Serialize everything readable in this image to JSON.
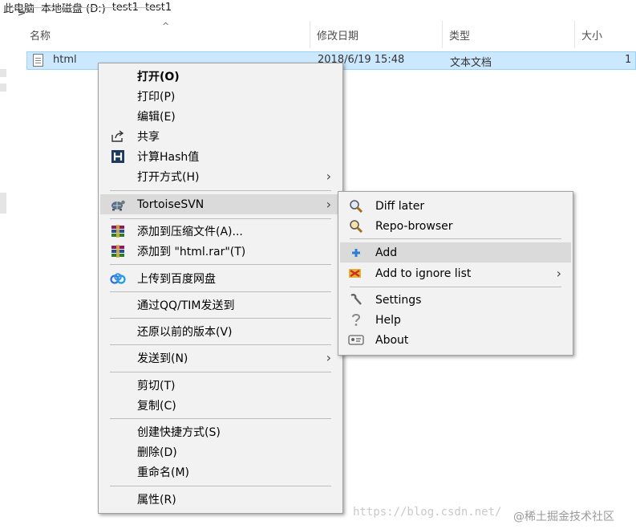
{
  "breadcrumb": [
    "此电脑",
    "本地磁盘 (D:)",
    "test1",
    "test1"
  ],
  "columns": {
    "name": "名称",
    "modified": "修改日期",
    "type": "类型",
    "size": "大小"
  },
  "file": {
    "name": "html",
    "modified": "2018/6/19 15:48",
    "type": "文本文档",
    "size": "1"
  },
  "context_menu": {
    "open": "打开(O)",
    "print": "打印(P)",
    "edit": "编辑(E)",
    "share": "共享",
    "hash": "计算Hash值",
    "open_with": "打开方式(H)",
    "tortoise": "TortoiseSVN",
    "add_archive": "添加到压缩文件(A)...",
    "add_rar": "添加到 \"html.rar\"(T)",
    "baidu": "上传到百度网盘",
    "qq": "通过QQ/TIM发送到",
    "restore": "还原以前的版本(V)",
    "send_to": "发送到(N)",
    "cut": "剪切(T)",
    "copy": "复制(C)",
    "shortcut": "创建快捷方式(S)",
    "delete": "删除(D)",
    "rename": "重命名(M)",
    "properties": "属性(R)"
  },
  "submenu": {
    "diff_later": "Diff later",
    "repo_browser": "Repo-browser",
    "add": "Add",
    "add_ignore": "Add to ignore list",
    "settings": "Settings",
    "help": "Help",
    "about": "About"
  },
  "icons": {
    "share": "share-icon",
    "hash": "hash-h-icon",
    "tortoise": "tortoise-icon",
    "winrar": "winrar-books-icon",
    "baidu": "baidu-cloud-icon",
    "submenu_arrow": "chevron-right-icon"
  },
  "watermark": {
    "url": "https://blog.csdn.net/",
    "community": "@稀土掘金技术社区"
  }
}
